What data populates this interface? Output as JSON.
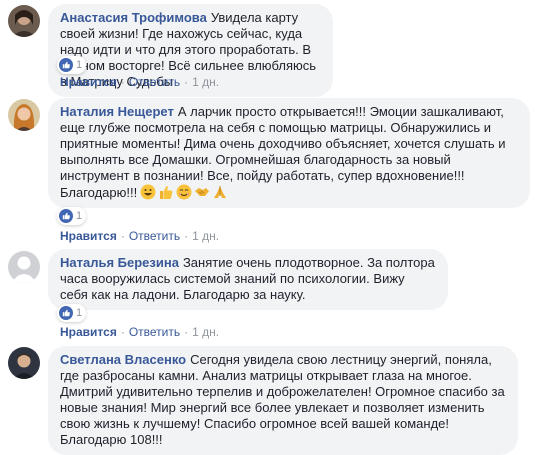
{
  "comments": [
    {
      "author": "Анастасия Трофимова",
      "text": "Увидела карту своей жизни! Где нахожусь сейчас, куда надо идти и что для этого проработать. В полном восторге! Всё сильнее влюбляюсь в Матрицу Судьбы",
      "like_count": "1",
      "like_label": "Нравится",
      "reply_label": "Ответить",
      "time": "1 дн.",
      "avatar": "dark-profile-photo"
    },
    {
      "author": "Наталия Нещерет",
      "text": "А ларчик просто открывается!!! Эмоции зашкаливают, еще глубже посмотрела на себя с помощью матрицы. Обнаружились и приятные моменты! Дима очень доходчиво объясняет, хочется слушать и выполнять все Домашки. Огромнейшая благодарность за новый инструмент в познании! Все, пойду работать, супер вдохновение!!! Благодарю!!!",
      "emojis": [
        "grinning-emoji",
        "thumbs-up-emoji",
        "smiling-emoji",
        "handshake-emoji",
        "praying-hands-emoji"
      ],
      "like_count": "1",
      "like_label": "Нравится",
      "reply_label": "Ответить",
      "time": "1 дн.",
      "avatar": "woman-profile-photo"
    },
    {
      "author": "Наталья Березина",
      "text": "Занятие очень плодотворное. За полтора часа вооружилась системой знаний по психологии. Вижу себя как на ладони. Благодарю за науку.",
      "like_count": "1",
      "like_label": "Нравится",
      "reply_label": "Ответить",
      "time": "1 дн.",
      "avatar": "default-silhouette"
    },
    {
      "author": "Светлана Власенко",
      "text": "Сегодня увидела свою лестницу энергий, поняла, где разбросаны камни. Анализ матрицы открывает глаза на многое. Дмитрий удивительно терпелив и доброжелателен! Огромное спасибо за новые знания! Мир энергий все более увлекает и позволяет изменить свою жизнь к лучшему! Спасибо огромное всей вашей команде! Благодарю 108!!!",
      "avatar": "man-profile-photo"
    }
  ],
  "colors": {
    "author": "#385898",
    "bubble": "#f2f3f5",
    "meta": "#90949c",
    "like_badge": "#4267b2"
  }
}
